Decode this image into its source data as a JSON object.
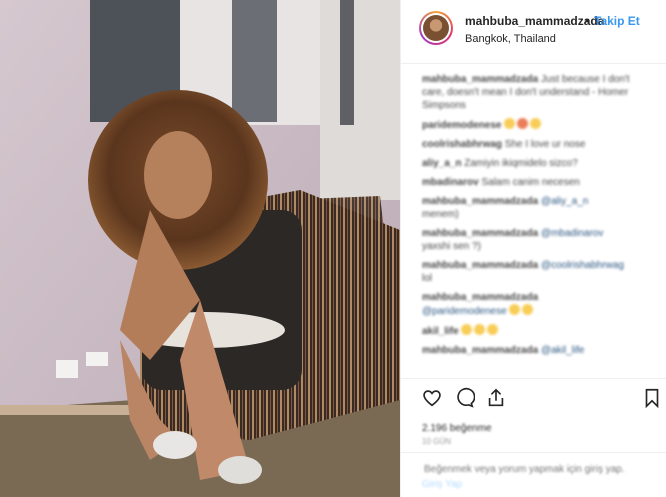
{
  "post": {
    "username": "mahbuba_mammadzada",
    "separator": "•",
    "follow_label": "Takip Et",
    "location": "Bangkok, Thailand"
  },
  "comments": [
    {
      "user": "mahbuba_mammadzada",
      "text": "Just because I don't care, doesn't mean I don't understand - Homer Simpsons"
    },
    {
      "user": "paridemodenese",
      "text": ""
    },
    {
      "user": "coolrishabhrwag",
      "text": "She I love ur nose"
    },
    {
      "user": "aliy_a_n",
      "text": "Zamiyin ikiqmidelo sizco?"
    },
    {
      "user": "mbadinarov",
      "text": "Salam canim necesen"
    },
    {
      "user": "mahbuba_mammadzada",
      "mention": "@aliy_a_n",
      "text": "menem)"
    },
    {
      "user": "mahbuba_mammadzada",
      "mention": "@mbadinarov",
      "text": "yaxshi sen ?)"
    },
    {
      "user": "mahbuba_mammadzada",
      "mention": "@coolrishabhrwag",
      "text": "lol"
    },
    {
      "user": "mahbuba_mammadzada",
      "mention": "@paridemodenese",
      "text": ""
    },
    {
      "user": "akil_life",
      "text": ""
    },
    {
      "user": "mahbuba_mammadzada",
      "mention": "@akil_life",
      "text": ""
    }
  ],
  "actions": {
    "likes_text": "2.196 beğenme",
    "date_text": "10 GÜN"
  },
  "comment_bar": {
    "placeholder": "Beğenmek veya yorum yapmak için giriş yap.",
    "post_label": "Giriş Yap"
  },
  "icons": [
    "heart-icon",
    "comment-icon",
    "share-icon",
    "bookmark-icon"
  ]
}
